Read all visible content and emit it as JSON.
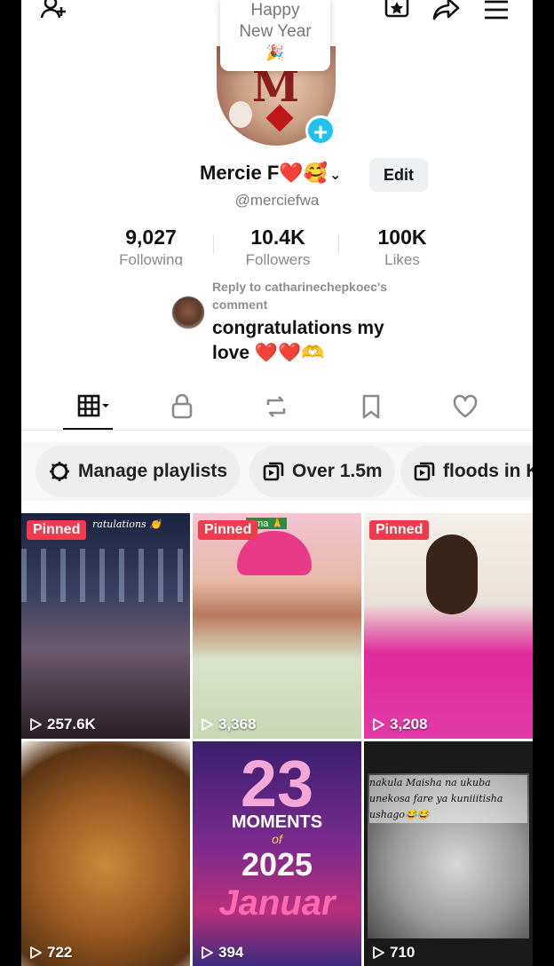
{
  "bubble": {
    "line1": "Happy",
    "line2": "New Year",
    "emoji": "🎉"
  },
  "profile": {
    "name": "Mercie F❤️🥰",
    "handle": "@merciefwa",
    "edit_label": "Edit",
    "avatar_letter": "M"
  },
  "stats": [
    {
      "value": "9,027",
      "label": "Following"
    },
    {
      "value": "10.4K",
      "label": "Followers"
    },
    {
      "value": "100K",
      "label": "Likes"
    }
  ],
  "reply": {
    "header": "Reply to catharinechepkoec's comment",
    "text": "congratulations my love ❤️❤️🫶"
  },
  "chips": [
    {
      "label": "Manage playlists"
    },
    {
      "label": "Over 1.5m"
    },
    {
      "label": "floods in K"
    }
  ],
  "videos": [
    {
      "views": "257.6K",
      "pinned": "Pinned",
      "caption": "ratulations 👏"
    },
    {
      "views": "3,368",
      "pinned": "Pinned",
      "caption": "ama 🙏"
    },
    {
      "views": "3,208",
      "pinned": "Pinned"
    },
    {
      "views": "722"
    },
    {
      "views": "394",
      "overlay_big": "23",
      "overlay_mid": "MOMENTS",
      "overlay_of": "of",
      "overlay_year": "2025",
      "overlay_month": "Januar"
    },
    {
      "views": "710",
      "caption": "nakula Maisha na ukuba unekosa fare ya kuniiitisha ushago😂😂"
    }
  ],
  "colors": {
    "accent": "#20c3ee",
    "pinned": "#f13a4c",
    "like": "#e02a3a"
  }
}
